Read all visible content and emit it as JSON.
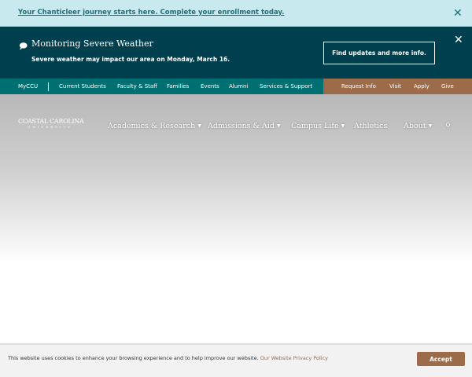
{
  "announcement": {
    "link": "Your Chanticleer journey starts here. Complete your enrollment today."
  },
  "alert": {
    "title": "Monitoring Severe Weather",
    "message": "Severe weather may impact our area on Monday, March 16.",
    "button": "Find updates and more info."
  },
  "utility_nav": {
    "left": [
      "MyCCU",
      "Current Students",
      "Faculty & Staff",
      "Families",
      "Events",
      "Alumni",
      "Services & Support"
    ],
    "right": [
      "Request Info",
      "Visit",
      "Apply",
      "Give"
    ]
  },
  "logo": {
    "name": "COASTAL CAROLINA",
    "sub": "UNIVERSITY"
  },
  "main_nav": [
    "Academics & Research",
    "Admissions & Aid",
    "Campus Life",
    "Athletics",
    "About"
  ],
  "cookie": {
    "text": "This website uses cookies to enhance your browsing experience and to help improve our website.",
    "link": "Our Website Privacy Policy",
    "accept": "Accept"
  },
  "colors": {
    "teal": "#006f72",
    "dark": "#003f4d",
    "bronze": "#9b6b4a",
    "light": "#c8e9ee"
  }
}
